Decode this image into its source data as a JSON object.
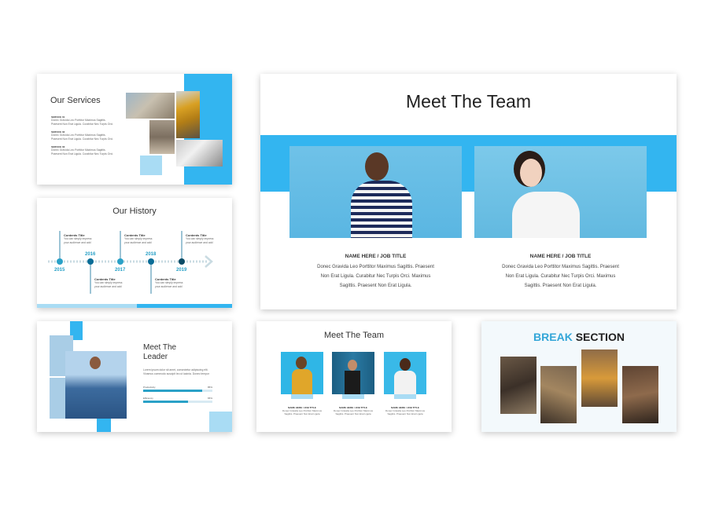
{
  "colors": {
    "accent": "#33b5f0",
    "accent_light": "#a9dcf4",
    "dark_blue": "#0a6c96",
    "teal": "#2aa1c7"
  },
  "services": {
    "title": "Our Services",
    "items": [
      {
        "heading": "SERVICE 01",
        "text": "Donec Gravida Leo Porttitor Maximus Sagittis. Praesent Non Erat Ligula. Curabitur Nec Turpis Orci."
      },
      {
        "heading": "SERVICE 02",
        "text": "Donec Gravida Leo Porttitor Maximus Sagittis. Praesent Non Erat Ligula. Curabitur Nec Turpis Orci."
      },
      {
        "heading": "SERVICE 03",
        "text": "Donec Gravida Leo Porttitor Maximus Sagittis. Praesent Non Erat Ligula. Curabitur Nec Turpis Orci."
      }
    ]
  },
  "history": {
    "title": "Our History",
    "years": [
      "2015",
      "2016",
      "2017",
      "2018",
      "2019"
    ],
    "top_items": [
      {
        "title": "Contents Title",
        "text": "You can simply impress your audience and add"
      },
      {
        "title": "Contents Title",
        "text": "You can simply impress your audience and add"
      },
      {
        "title": "Contents Title",
        "text": "You can simply impress your audience and add"
      }
    ],
    "bottom_items": [
      {
        "title": "Contents Title",
        "text": "You can simply impress your audience and add"
      },
      {
        "title": "Contents Title",
        "text": "You can simply impress your audience and add"
      }
    ]
  },
  "leader": {
    "title_line1": "Meet The",
    "title_line2": "Leader",
    "description": "Lorem ipsum dolor sit amet, consectetur adipiscing elit. Vivamus commodo suscipit leo ut lacinia. Donec tempor",
    "bars": [
      {
        "label": "Productivity",
        "value_text": "85%",
        "value": 0.85
      },
      {
        "label": "Efficiency",
        "value_text": "65%",
        "value": 0.65
      }
    ]
  },
  "team_big": {
    "title": "Meet The Team",
    "members": [
      {
        "name": "NAME HERE / JOB TITLE",
        "desc_line1": "Donec Gravida Leo Porttitor Maximus Sagittis. Praesent",
        "desc_line2": "Non Erat Ligula. Curabitur Nec Turpis Orci. Maximus",
        "desc_line3": "Sagittis. Praesent Non Erat Ligula."
      },
      {
        "name": "NAME HERE / JOB TITLE",
        "desc_line1": "Donec Gravida Leo Porttitor Maximus Sagittis. Praesent",
        "desc_line2": "Non Erat Ligula. Curabitur Nec Turpis Orci. Maximus",
        "desc_line3": "Sagittis. Praesent Non Erat Ligula."
      }
    ]
  },
  "team_small": {
    "title": "Meet The Team",
    "members": [
      {
        "name": "NAME HERE / JOB TITLE",
        "text": "Donec Gravida Leo Porttitor Maximus Sagittis. Praesent Non Erat Ligula"
      },
      {
        "name": "NAME HERE / JOB TITLE",
        "text": "Donec Gravida Leo Porttitor Maximus Sagittis. Praesent Non Erat Ligula"
      },
      {
        "name": "NAME HERE / JOB TITLE",
        "text": "Donec Gravida Leo Porttitor Maximus Sagittis. Praesent Non Erat Ligula"
      }
    ]
  },
  "break_section": {
    "word1": "BREAK",
    "word2": "SECTION"
  }
}
